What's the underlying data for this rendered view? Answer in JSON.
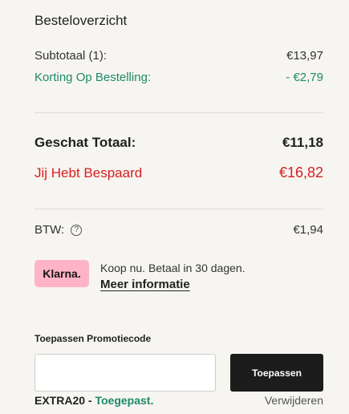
{
  "summary": {
    "title": "Besteloverzicht",
    "subtotal_label": "Subtotaal (1):",
    "subtotal_value": "€13,97",
    "discount_label": "Korting Op Bestelling:",
    "discount_value": "- €2,79",
    "total_label": "Geschat Totaal:",
    "total_value": "€11,18",
    "saved_label": "Jij Hebt Bespaard",
    "saved_value": "€16,82",
    "vat_label": "BTW:",
    "vat_value": "€1,94",
    "help_icon": "?"
  },
  "klarna": {
    "badge": "Klarna.",
    "text": "Koop nu. Betaal in 30 dagen.",
    "link": "Meer informatie"
  },
  "promo": {
    "label": "Toepassen Promotiecode",
    "input_value": "",
    "button": "Toepassen",
    "code": "EXTRA20",
    "separator": " - ",
    "status": "Toegepast.",
    "remove": "Verwijderen"
  },
  "colors": {
    "accent_green": "#1e8a6a",
    "saved_red": "#d81e1e",
    "klarna_pink": "#ffb3c7",
    "button_dark": "#1c1c1c"
  }
}
